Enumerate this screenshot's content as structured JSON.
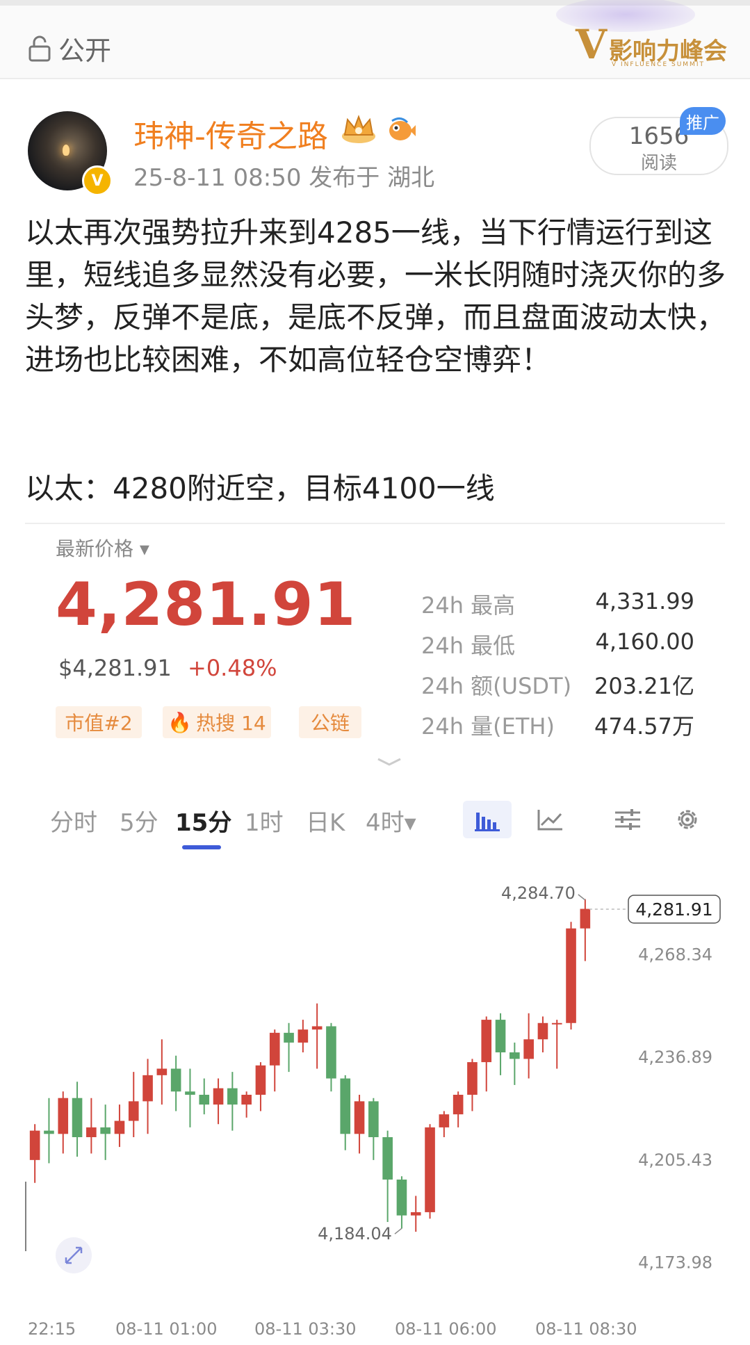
{
  "header": {
    "visibility": "公开",
    "logo_main": "影响力峰会",
    "logo_sub": "V INFLUENCE SUMMIT"
  },
  "post": {
    "username": "玮神-传奇之路",
    "avatar_badge": "V",
    "meta": "25-8-11 08:50  发布于 湖北",
    "read_count": "1656",
    "read_label": "阅读",
    "ad_tag": "推广",
    "body": "以太再次强势拉升来到4285一线，当下行情运行到这里，短线追多显然没有必要，一米长阴随时浇灭你的多头梦，反弹不是底，是底不反弹，而且盘面波动太快，进场也比较困难，不如高位轻仓空博弈！",
    "body2": "以太：4280附近空，目标4100一线"
  },
  "ticker": {
    "latest_label": "最新价格 ▾",
    "price": "4,281.91",
    "usd_price": "$4,281.91",
    "change_pct": "+0.48%",
    "tags": [
      "市值#2",
      "热搜 14",
      "公链"
    ],
    "stats": [
      {
        "label": "24h 最高",
        "value": "4,331.99"
      },
      {
        "label": "24h 最低",
        "value": "4,160.00"
      },
      {
        "label": "24h 额(USDT)",
        "value": "203.21亿"
      },
      {
        "label": "24h 量(ETH)",
        "value": "474.57万"
      }
    ]
  },
  "tabs": [
    "分时",
    "5分",
    "15分",
    "1时",
    "日K",
    "4时▾"
  ],
  "active_tab": "15分",
  "icons": {
    "candle": "candlestick-icon",
    "line": "line-chart-icon",
    "settings_sliders": "sliders-icon",
    "gear": "gear-icon",
    "expand": "expand-icon",
    "lock": "unlock-icon"
  },
  "colors": {
    "up": "#d1453b",
    "down": "#5aa66a",
    "accent": "#3e5bd8",
    "username": "#f07f20"
  },
  "chart_data": {
    "type": "candlestick",
    "y_ticks": [
      "4,268.34",
      "4,236.89",
      "4,205.43",
      "4,173.98"
    ],
    "x_ticks": [
      "22:15",
      "08-11 01:00",
      "08-11 03:30",
      "08-11 06:00",
      "08-11 08:30"
    ],
    "ylim": [
      4160,
      4290
    ],
    "current_price_label": "4,281.91",
    "high_label": "4,284.70",
    "low_label": "4,184.04",
    "candles": [
      [
        4205,
        4214,
        4198,
        4216
      ],
      [
        4214,
        4213,
        4204,
        4224
      ],
      [
        4213,
        4224,
        4207,
        4226
      ],
      [
        4224,
        4212,
        4206,
        4229
      ],
      [
        4212,
        4215,
        4207,
        4224
      ],
      [
        4215,
        4213,
        4205,
        4222
      ],
      [
        4213,
        4217,
        4209,
        4222
      ],
      [
        4217,
        4223,
        4212,
        4232
      ],
      [
        4223,
        4231,
        4213,
        4236
      ],
      [
        4231,
        4233,
        4222,
        4242
      ],
      [
        4233,
        4226,
        4220,
        4237
      ],
      [
        4226,
        4225,
        4215,
        4233
      ],
      [
        4225,
        4222,
        4219,
        4230
      ],
      [
        4222,
        4227,
        4216,
        4230
      ],
      [
        4227,
        4222,
        4214,
        4232
      ],
      [
        4222,
        4225,
        4218,
        4226
      ],
      [
        4225,
        4234,
        4220,
        4235
      ],
      [
        4234,
        4244,
        4226,
        4245
      ],
      [
        4244,
        4241,
        4232,
        4247
      ],
      [
        4241,
        4245,
        4238,
        4248
      ],
      [
        4245,
        4246,
        4233,
        4253
      ],
      [
        4246,
        4230,
        4226,
        4247
      ],
      [
        4230,
        4213,
        4208,
        4231
      ],
      [
        4213,
        4223,
        4207,
        4225
      ],
      [
        4223,
        4212,
        4205,
        4224
      ],
      [
        4212,
        4199,
        4186,
        4214
      ],
      [
        4199,
        4188,
        4184,
        4200
      ],
      [
        4188,
        4189,
        4183,
        4194
      ],
      [
        4189,
        4215,
        4187,
        4216
      ],
      [
        4215,
        4219,
        4212,
        4220
      ],
      [
        4219,
        4225,
        4215,
        4226
      ],
      [
        4225,
        4235,
        4220,
        4236
      ],
      [
        4235,
        4248,
        4226,
        4249
      ],
      [
        4248,
        4238,
        4231,
        4250
      ],
      [
        4238,
        4236,
        4228,
        4241
      ],
      [
        4236,
        4242,
        4230,
        4250
      ],
      [
        4242,
        4247,
        4238,
        4249
      ],
      [
        4247,
        4247,
        4233,
        4248
      ],
      [
        4247,
        4276,
        4245,
        4278
      ],
      [
        4276,
        4282,
        4266,
        4285
      ]
    ],
    "candle_format": [
      "open",
      "close",
      "low",
      "high"
    ]
  }
}
